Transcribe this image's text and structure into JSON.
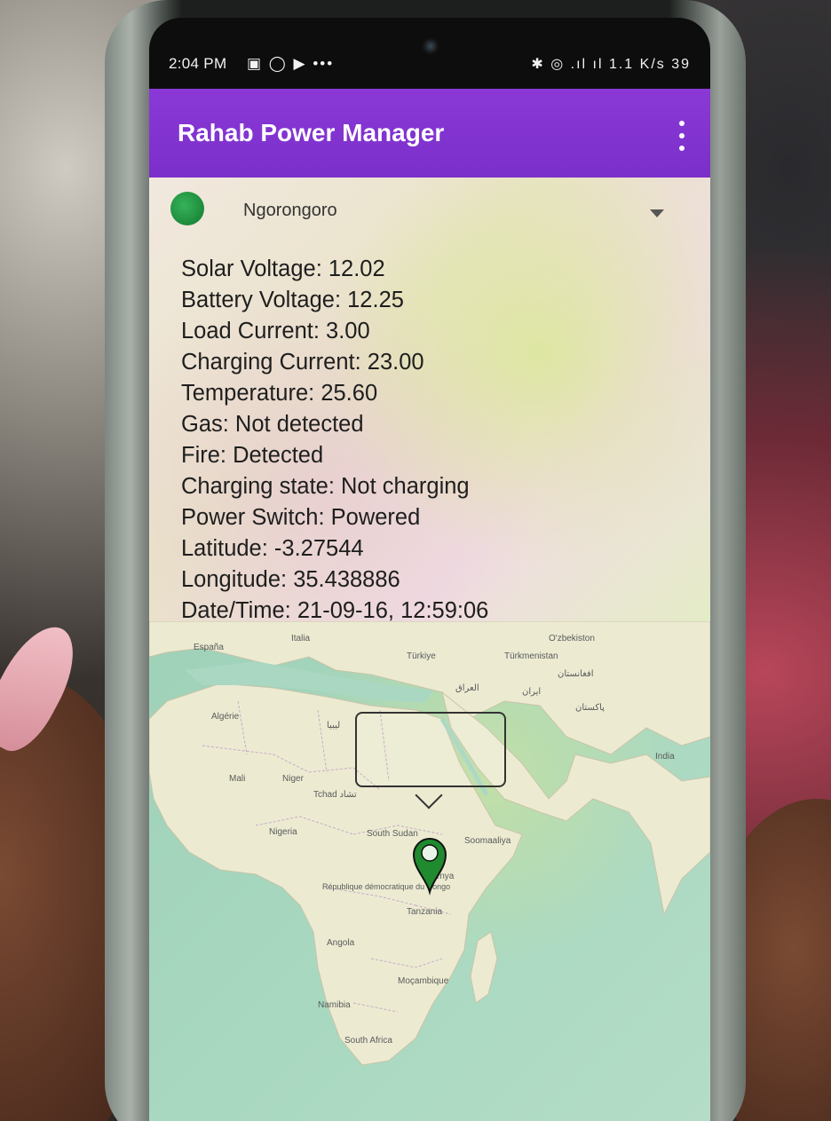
{
  "status_bar": {
    "time": "2:04 PM",
    "left_icons": "▣ ◯ ▶ •••",
    "right_icons": "✱ ◎ .ıl ıl 1.1 K/s 39"
  },
  "app_bar": {
    "title": "Rahab Power Manager",
    "menu_icon": "more-vertical-icon",
    "color": "#7b2fca"
  },
  "device_selector": {
    "selected": "Ngorongoro",
    "status_color": "#1d8a3b"
  },
  "readings": [
    "Solar Voltage: 12.02",
    "Battery Voltage: 12.25",
    "Load Current: 3.00",
    "Charging Current: 23.00",
    "Temperature: 25.60",
    "Gas: Not detected",
    "Fire: Detected",
    "Charging state: Not charging",
    "Power Switch: Powered",
    "Latitude: -3.27544",
    "Longitude: 35.438886",
    "Date/Time: 21-09-16, 12:59:06"
  ],
  "map": {
    "labels": {
      "espana": "España",
      "italia": "Italia",
      "turkiye": "Türkiye",
      "ozbekiston": "O'zbekiston",
      "turkmenistan": "Türkmenistan",
      "algerie": "Algérie",
      "libya": "ليبيا",
      "iraq": "العراق",
      "iran": "ایران",
      "afghanistan": "افغانستان",
      "pakistan": "پاکستان",
      "india": "India",
      "mali": "Mali",
      "niger": "Niger",
      "tchad": "Tchad تشاد",
      "nigeria": "Nigeria",
      "south_sudan": "South Sudan",
      "soomaaliya": "Soomaaliya",
      "kenya": "Kenya",
      "rdc": "République démocratique du Congo",
      "tanzania": "Tanzania",
      "angola": "Angola",
      "mocambique": "Moçambique",
      "namibia": "Namibia",
      "south_africa": "South Africa"
    },
    "marker_icon": "map-pin-icon",
    "marker_color": "#1f8a2e"
  }
}
